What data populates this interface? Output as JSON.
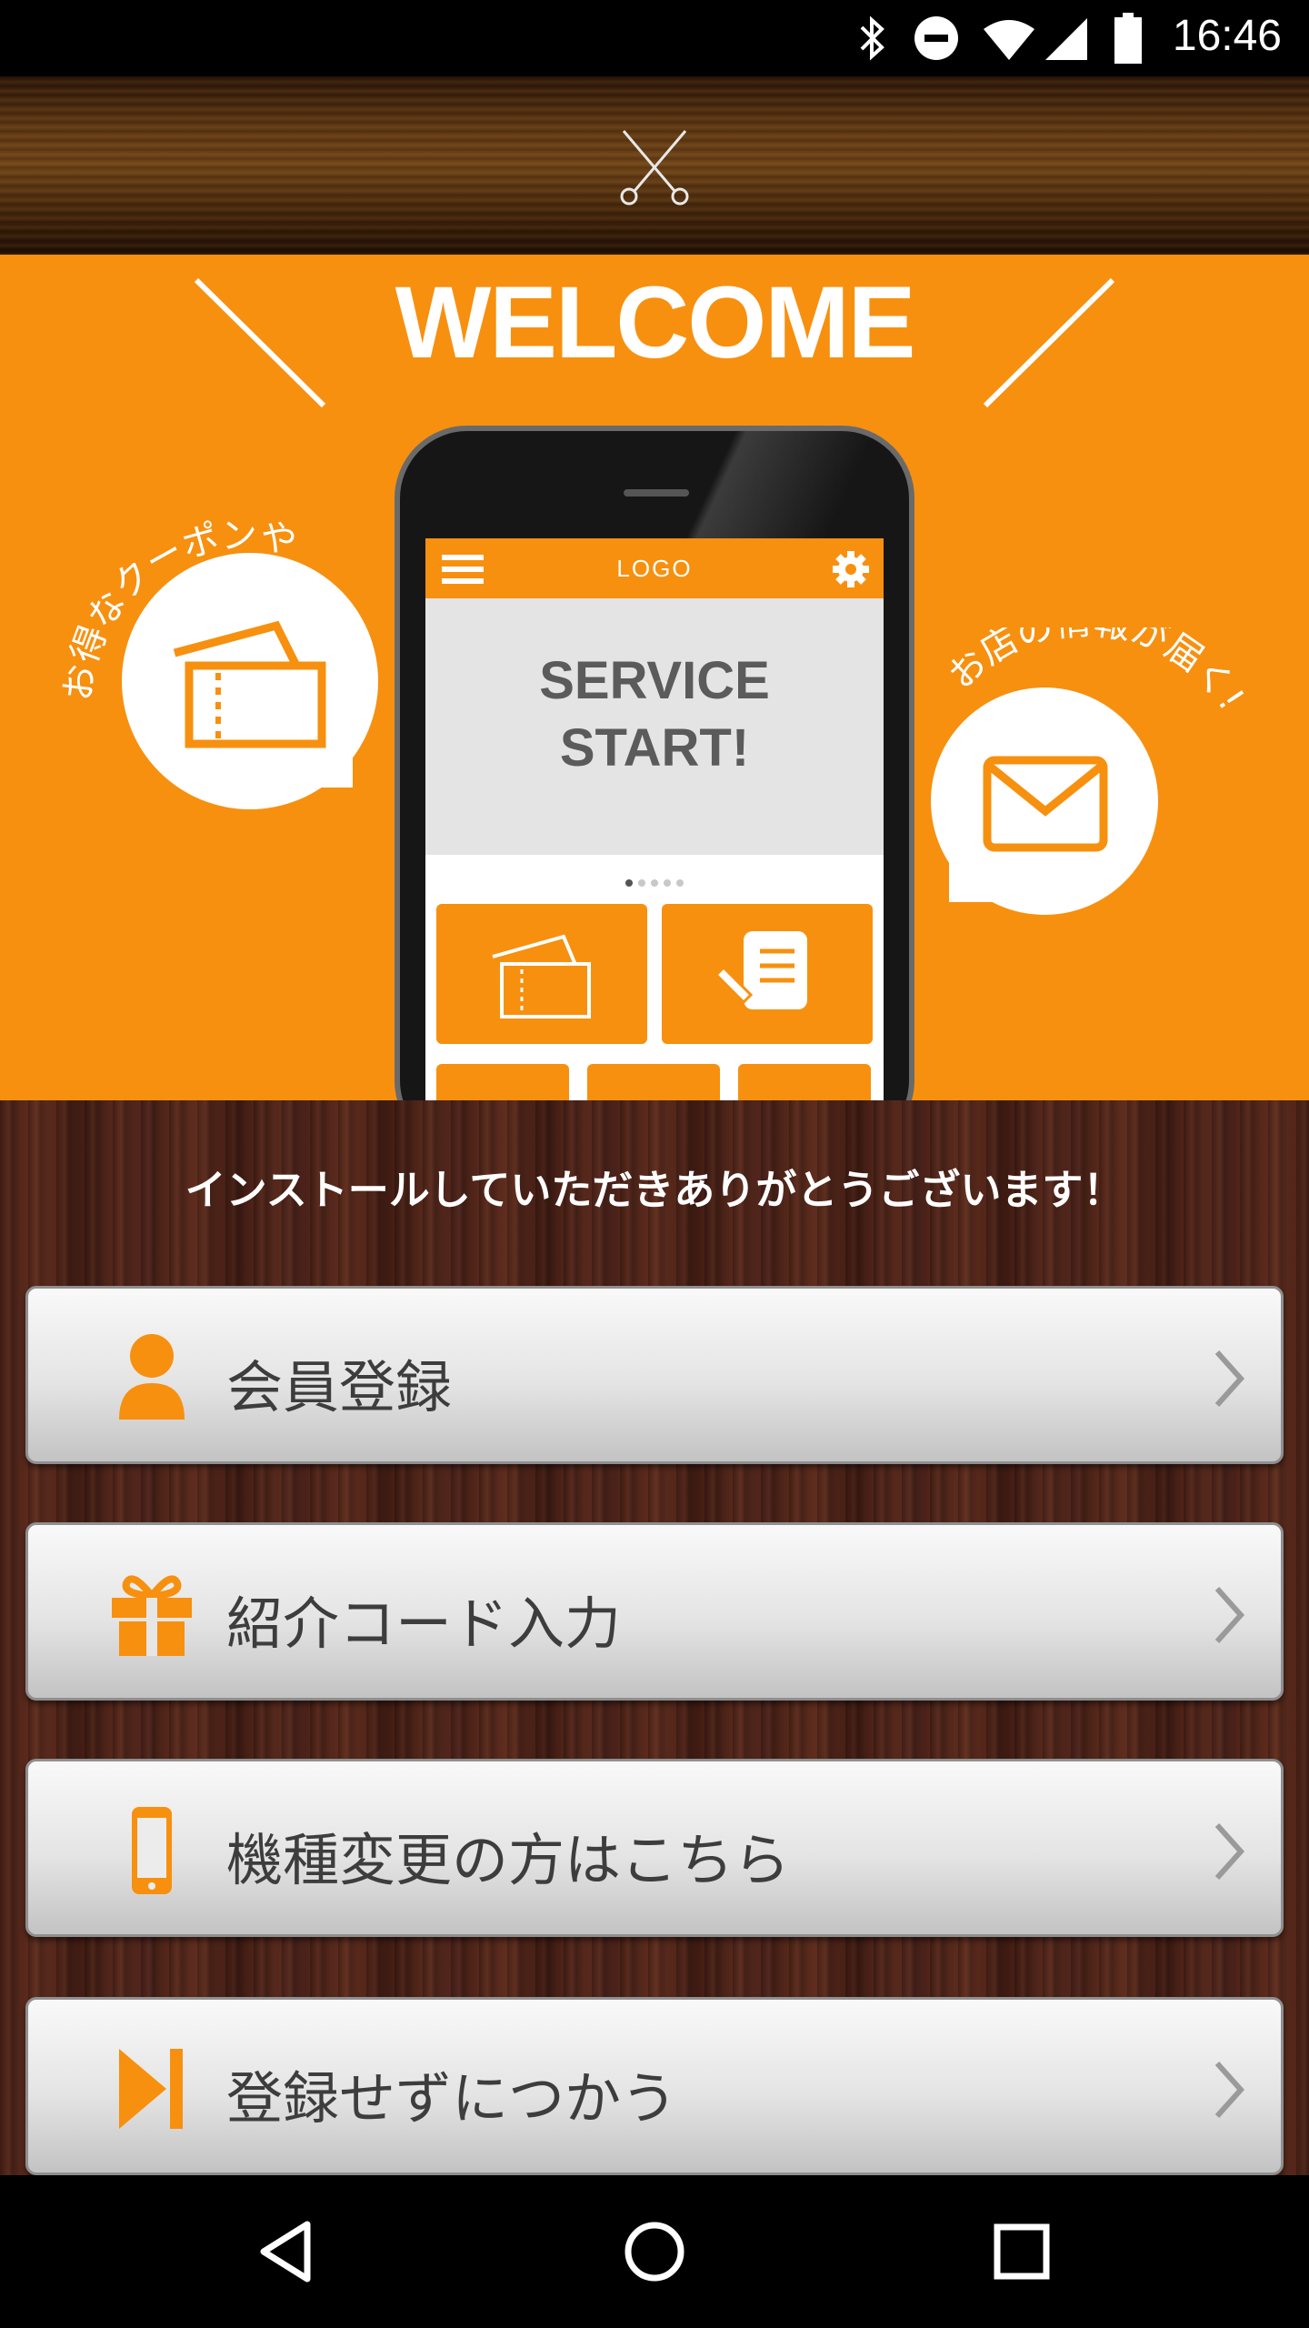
{
  "status_bar": {
    "time": "16:46"
  },
  "header": {
    "logo_icon": "scissors-icon"
  },
  "banner": {
    "title": "WELCOME",
    "phone": {
      "app_logo": "LOGO",
      "headline_line1": "SERVICE",
      "headline_line2": "START!"
    },
    "bubble_left_caption": "お得なクーポンや",
    "bubble_right_caption": "お店の情報が届く!",
    "accent_color": "#f7900f"
  },
  "main": {
    "thanks_message": "インストールしていただきありがとうございます！",
    "buttons": [
      {
        "label": "会員登録",
        "icon": "person-icon"
      },
      {
        "label": "紹介コード入力",
        "icon": "gift-icon"
      },
      {
        "label": "機種変更の方はこちら",
        "icon": "smartphone-icon"
      },
      {
        "label": "登録せずにつかう",
        "icon": "skip-icon"
      }
    ]
  },
  "nav_bar": {
    "icons": [
      "back-icon",
      "home-icon",
      "recents-icon"
    ]
  }
}
